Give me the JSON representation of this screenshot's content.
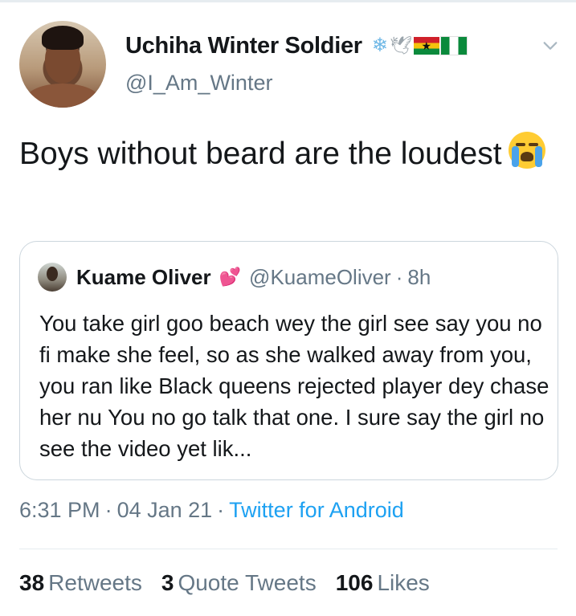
{
  "tweet": {
    "author": {
      "display_name": "Uchiha Winter Soldier",
      "handle": "@I_Am_Winter",
      "flair_icons": [
        "snowflake-icon",
        "dove-icon",
        "ghana-flag-icon",
        "nigeria-flag-icon"
      ]
    },
    "text": "Boys without beard are the loudest",
    "text_emoji": "loudly-crying-face-icon",
    "quoted": {
      "display_name": "Kuame Oliver",
      "name_emoji": "two-hearts-icon",
      "handle": "@KuameOliver",
      "separator": "·",
      "time": "8h",
      "text": "You take girl goo beach wey the girl see say you no fi make she feel, so as she walked away from you, you ran like Black queens rejected player dey chase her nu You no go talk that one. I sure say the girl no see the video yet lik..."
    },
    "meta": {
      "time": "6:31 PM",
      "separator": "·",
      "date": "04 Jan 21",
      "source": "Twitter for Android"
    },
    "stats": {
      "retweets_count": "38",
      "retweets_label": "Retweets",
      "quotes_count": "3",
      "quotes_label": "Quote Tweets",
      "likes_count": "106",
      "likes_label": "Likes"
    }
  },
  "colors": {
    "text_primary": "#14171a",
    "text_secondary": "#657786",
    "link": "#1da1f2",
    "border": "#ccd6dd"
  }
}
